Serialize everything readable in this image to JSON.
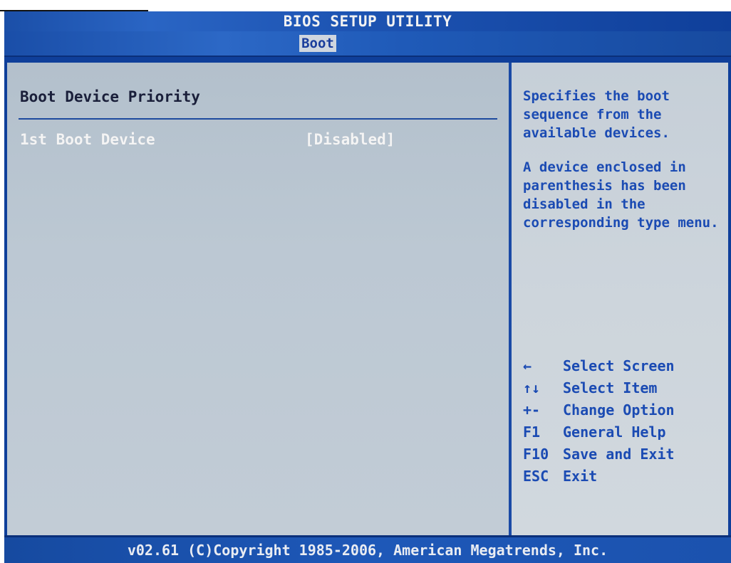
{
  "header": {
    "title": "BIOS SETUP UTILITY",
    "active_tab": "Boot"
  },
  "main": {
    "section_title": "Boot Device Priority",
    "items": [
      {
        "label": "1st Boot Device",
        "value": "[Disabled]"
      }
    ]
  },
  "help": {
    "paragraphs": [
      "Specifies the boot sequence from the available devices.",
      "A device enclosed in parenthesis has been disabled in the corresponding type menu."
    ]
  },
  "keys": [
    {
      "key": "←",
      "desc": "Select Screen"
    },
    {
      "key": "↑↓",
      "desc": "Select Item"
    },
    {
      "key": "+-",
      "desc": "Change Option"
    },
    {
      "key": "F1",
      "desc": "General Help"
    },
    {
      "key": "F10",
      "desc": "Save and Exit"
    },
    {
      "key": "ESC",
      "desc": "Exit"
    }
  ],
  "footer": {
    "copyright": "v02.61 (C)Copyright 1985-2006, American Megatrends, Inc."
  },
  "colors": {
    "bios_blue": "#0f3f9a",
    "panel_gray": "#bcc8d3",
    "help_text_blue": "#1b4bb3",
    "highlight_white": "#f4f4f4"
  }
}
